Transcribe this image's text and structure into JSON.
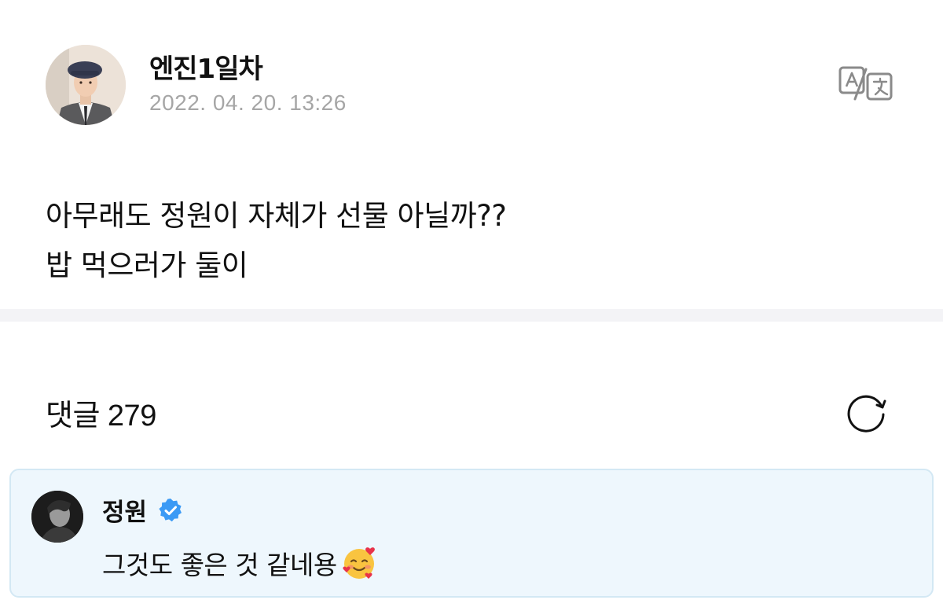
{
  "post": {
    "author": "엔진1일차",
    "timestamp": "2022. 04. 20. 13:26",
    "body_lines": [
      "아무래도 정원이 자체가 선물 아닐까??",
      "밥 먹으러가 둘이"
    ],
    "translate_icon": "translate-icon"
  },
  "comments": {
    "label": "댓글",
    "count": "279",
    "refresh_icon": "refresh-icon",
    "items": [
      {
        "author": "정원",
        "verified": true,
        "text": "그것도 좋은 것 같네용",
        "emoji": "smiling-face-with-hearts"
      }
    ]
  },
  "colors": {
    "timestamp": "#a6a6a6",
    "divider": "#f3f3f6",
    "comment_bg": "#eef7fd",
    "comment_border": "#d3e8f4",
    "verified": "#3b9af5"
  }
}
